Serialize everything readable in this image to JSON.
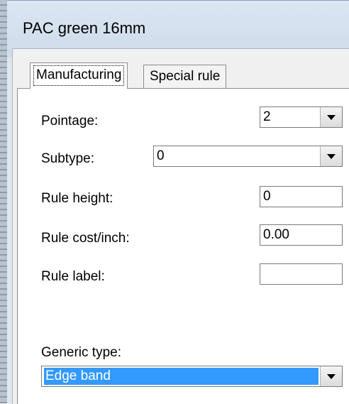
{
  "window": {
    "title": "PAC green 16mm"
  },
  "tabs": [
    {
      "label": "Manufacturing",
      "active": true
    },
    {
      "label": "Special rule",
      "active": false
    }
  ],
  "form": {
    "pointage": {
      "label": "Pointage:",
      "value": "2"
    },
    "subtype": {
      "label": "Subtype:",
      "value": "0"
    },
    "rule_height": {
      "label": "Rule height:",
      "value": "0"
    },
    "rule_cost": {
      "label": "Rule cost/inch:",
      "value": "0.00"
    },
    "rule_label": {
      "label": "Rule label:",
      "value": ""
    },
    "generic_type": {
      "label": "Generic type:",
      "value": "Edge band"
    }
  },
  "colors": {
    "selection": "#3399ff",
    "window_bg": "#f0f0f0",
    "titlebar": "#dbe6f3"
  }
}
